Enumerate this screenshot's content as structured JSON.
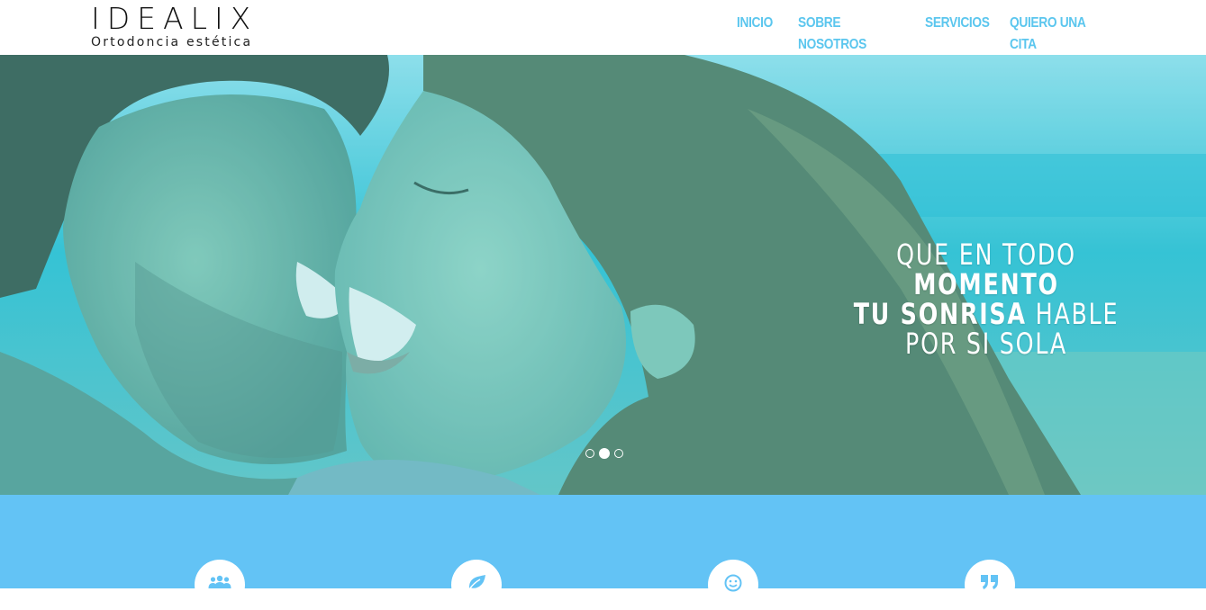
{
  "brand": {
    "logo": "IDEALIX",
    "tagline": "Ortodoncia estética"
  },
  "nav": {
    "items": [
      "INICIO",
      "SOBRE NOSOTROS",
      "SERVICIOS",
      "QUIERO UNA CITA"
    ]
  },
  "hero": {
    "line1_light": "QUE EN TODO ",
    "line1_bold": "MOMENTO",
    "line2_bold": "TU SONRISA",
    "line2_light": " HABLE",
    "line3_light": "POR SI SOLA",
    "slides": {
      "total": 3,
      "active_index": 2
    },
    "overlay_color": "#3ec6e0"
  },
  "features": {
    "icons": [
      "users-icon",
      "leaf-icon",
      "smile-icon",
      "quote-icon"
    ],
    "background": "#63c3f5"
  },
  "colors": {
    "nav_link": "#5bc6ee",
    "logo": "#111111"
  }
}
